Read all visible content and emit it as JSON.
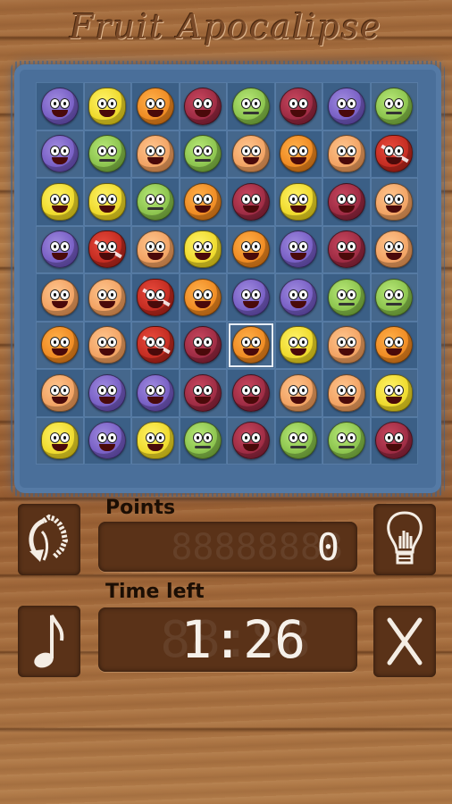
{
  "header": {
    "title": "Fruit Apocalipse"
  },
  "board": {
    "rows": [
      [
        "grape",
        "lemon",
        "orange",
        "pomegranate",
        "kiwi",
        "pomegranate",
        "grape",
        "kiwi"
      ],
      [
        "grape",
        "kiwi",
        "peach",
        "kiwi",
        "peach",
        "orange",
        "peach",
        "strawberry"
      ],
      [
        "lemon",
        "lemon",
        "kiwi",
        "orange",
        "pomegranate",
        "lemon",
        "pomegranate",
        "peach"
      ],
      [
        "grape",
        "strawberry",
        "peach",
        "lemon",
        "orange",
        "grape",
        "pomegranate",
        "peach"
      ],
      [
        "peach",
        "peach",
        "strawberry",
        "orange",
        "grape",
        "grape",
        "kiwi",
        "kiwi"
      ],
      [
        "orange",
        "peach",
        "strawberry",
        "pomegranate",
        "orange",
        "lemon",
        "peach",
        "orange"
      ],
      [
        "peach",
        "grape",
        "grape",
        "pomegranate",
        "pomegranate",
        "peach",
        "peach",
        "lemon"
      ],
      [
        "lemon",
        "grape",
        "lemon",
        "kiwi",
        "pomegranate",
        "kiwi",
        "kiwi",
        "pomegranate"
      ]
    ],
    "selected": {
      "row": 5,
      "col": 4
    }
  },
  "scoreboard": {
    "points_label": "Points",
    "points_value": "0",
    "points_ghost": "88888888",
    "time_label": "Time left",
    "time_value": "1:26",
    "time_ghost": "88:88"
  },
  "buttons": {
    "shuffle_icon": "shuffle-hand-icon",
    "hint_icon": "lightbulb-icon",
    "music_icon": "music-note-icon",
    "quit_icon": "close-x-icon"
  }
}
